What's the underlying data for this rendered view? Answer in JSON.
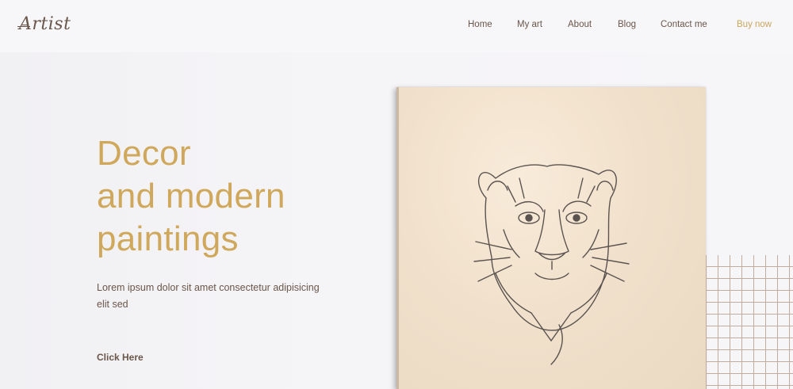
{
  "logo": "Artist",
  "nav": {
    "items": [
      {
        "label": "Home"
      },
      {
        "label": "My art"
      },
      {
        "label": "About"
      },
      {
        "label": "Blog"
      },
      {
        "label": "Contact me"
      },
      {
        "label": "Buy now"
      }
    ]
  },
  "hero": {
    "title_lines": [
      "Decor",
      "and modern",
      "paintings"
    ],
    "subtitle": "Lorem ipsum dolor sit amet consectetur adipisicing elit sed",
    "cta_label": "Click Here"
  },
  "colors": {
    "accent": "#cfa85b",
    "text": "#6a564a",
    "background": "#f4f3f6",
    "canvas": "#f1e1cc"
  },
  "icons": {
    "artwork": "tiger-sketch-icon",
    "decor": "wire-grid-icon"
  }
}
